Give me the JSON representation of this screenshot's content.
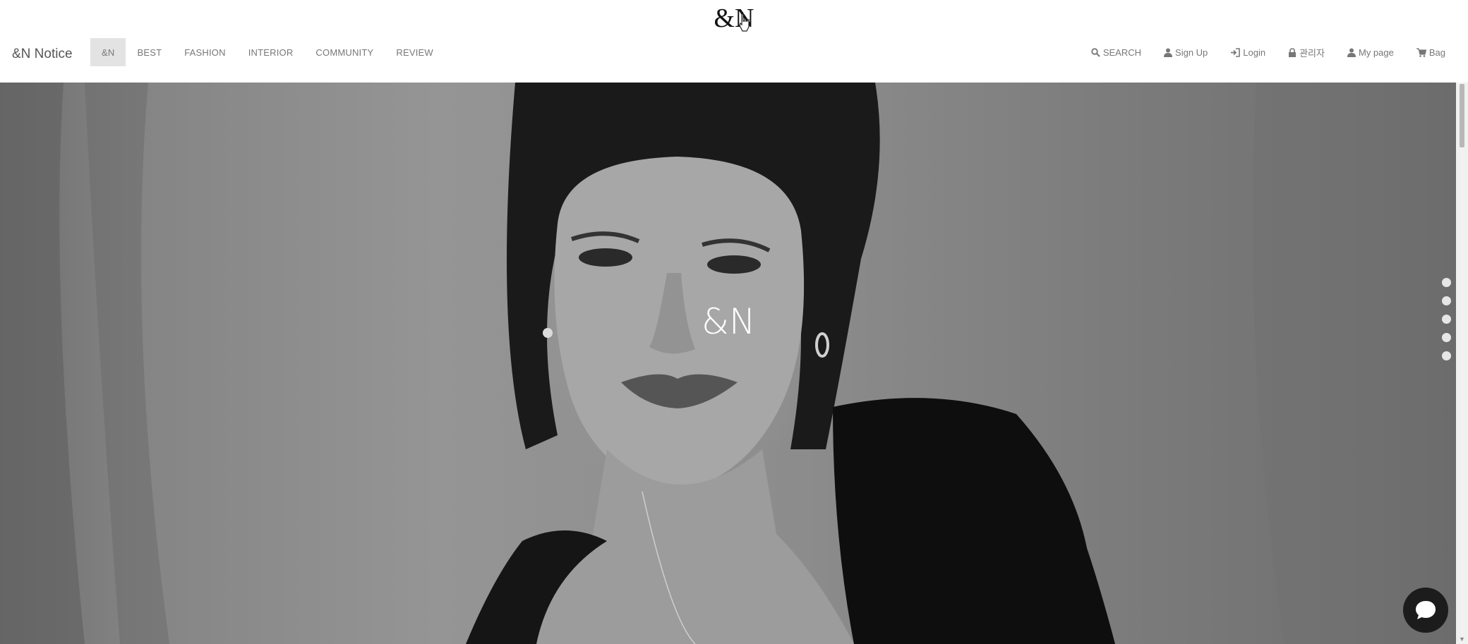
{
  "header": {
    "logo": "&N"
  },
  "nav": {
    "brand": "&N Notice",
    "menu": [
      {
        "label": "&N",
        "active": true
      },
      {
        "label": "BEST"
      },
      {
        "label": "FASHION"
      },
      {
        "label": "INTERIOR"
      },
      {
        "label": "COMMUNITY"
      },
      {
        "label": "REVIEW"
      }
    ],
    "utility": [
      {
        "label": "SEARCH",
        "icon": "search-icon"
      },
      {
        "label": "Sign Up",
        "icon": "user-icon"
      },
      {
        "label": "Login",
        "icon": "login-icon"
      },
      {
        "label": "관리자",
        "icon": "lock-icon"
      },
      {
        "label": "My page",
        "icon": "user-icon"
      },
      {
        "label": "Bag",
        "icon": "cart-icon"
      }
    ]
  },
  "hero": {
    "title": "&N",
    "slide_count": 5
  },
  "colors": {
    "hero_bg": "#8a8a8a",
    "chat_bg": "#1c1c1c"
  }
}
